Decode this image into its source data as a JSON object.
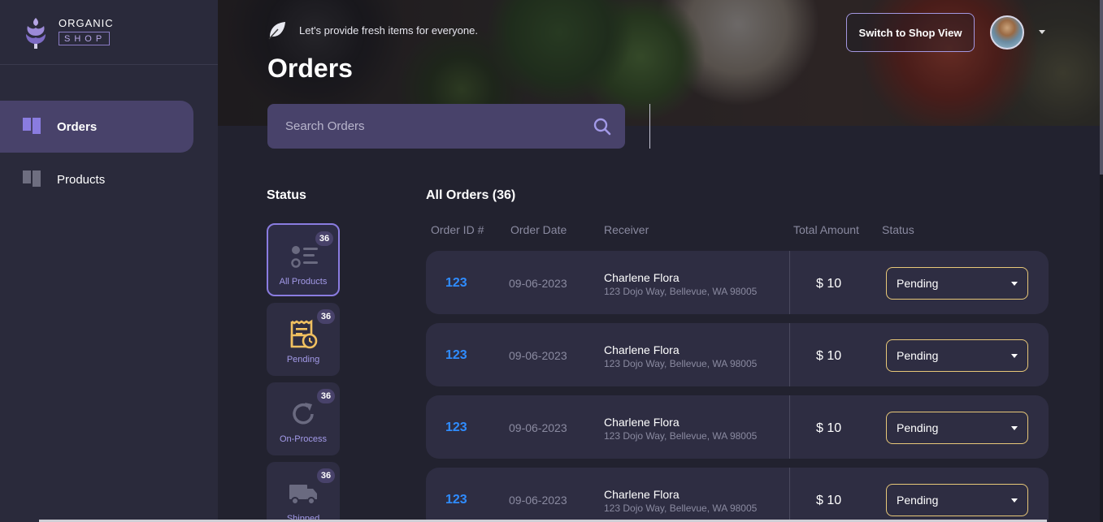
{
  "brand": {
    "line1": "ORGANIC",
    "line2": "SHOP"
  },
  "sidebar": {
    "items": [
      {
        "label": "Orders",
        "icon": "dashboard-grid-icon",
        "active": true
      },
      {
        "label": "Products",
        "icon": "dashboard-grid-icon",
        "active": false
      }
    ]
  },
  "header": {
    "tagline": "Let's provide fresh items for everyone.",
    "title": "Orders",
    "switch_label": "Switch to Shop View"
  },
  "search": {
    "placeholder": "Search Orders"
  },
  "status": {
    "title": "Status",
    "cards": [
      {
        "label": "All Products",
        "count": "36",
        "icon": "list-icon"
      },
      {
        "label": "Pending",
        "count": "36",
        "icon": "receipt-clock-icon"
      },
      {
        "label": "On-Process",
        "count": "36",
        "icon": "refresh-icon"
      },
      {
        "label": "Shipped",
        "count": "36",
        "icon": "truck-icon"
      }
    ]
  },
  "orders": {
    "title": "All Orders (36)",
    "columns": [
      "Order ID #",
      "Order Date",
      "Receiver",
      "Total Amount",
      "Status"
    ],
    "rows": [
      {
        "id": "123",
        "date": "09-06-2023",
        "name": "Charlene Flora",
        "address": "123 Dojo Way, Bellevue, WA 98005",
        "amount": "$ 10",
        "status": "Pending"
      },
      {
        "id": "123",
        "date": "09-06-2023",
        "name": "Charlene Flora",
        "address": "123 Dojo Way, Bellevue, WA 98005",
        "amount": "$ 10",
        "status": "Pending"
      },
      {
        "id": "123",
        "date": "09-06-2023",
        "name": "Charlene Flora",
        "address": "123 Dojo Way, Bellevue, WA 98005",
        "amount": "$ 10",
        "status": "Pending"
      },
      {
        "id": "123",
        "date": "09-06-2023",
        "name": "Charlene Flora",
        "address": "123 Dojo Way, Bellevue, WA 98005",
        "amount": "$ 10",
        "status": "Pending"
      }
    ]
  },
  "colors": {
    "accent": "#8a7ce0",
    "sidebar_active": "#48426a",
    "order_id": "#2f8cff",
    "status_border": "#e8c878"
  }
}
